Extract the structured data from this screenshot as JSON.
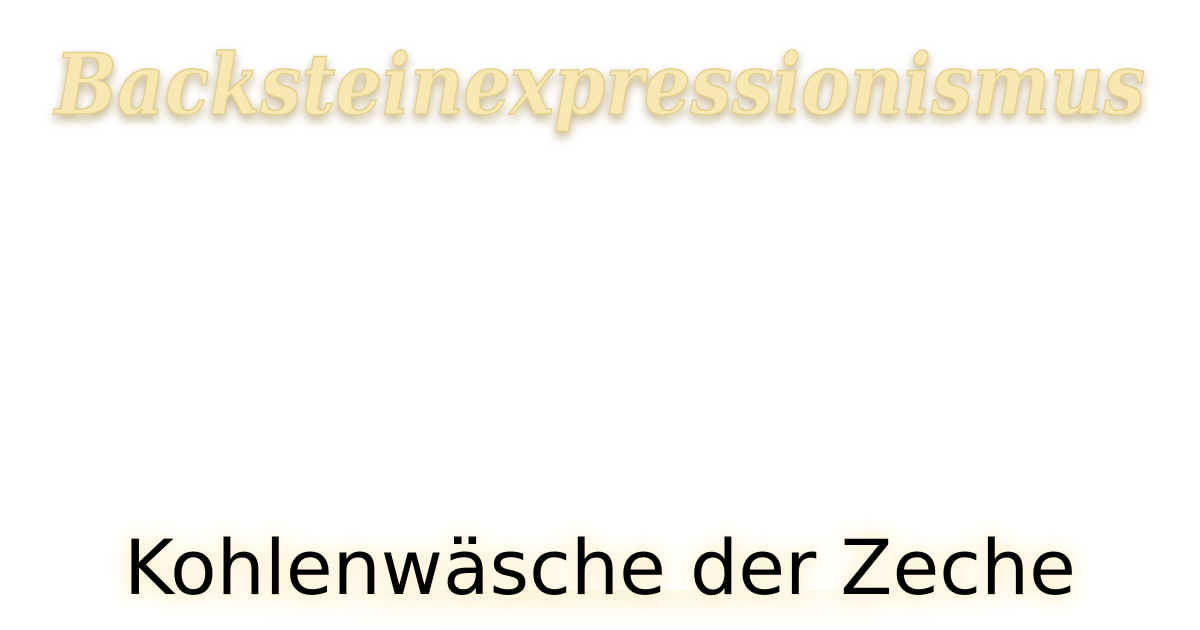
{
  "title": {
    "text": "Backsteinexpressionismus",
    "fill_color": "#f7e8b2",
    "stroke_color": "#e3cf8c",
    "glow_color": "#b8a77a"
  },
  "caption": {
    "text": "Kohlenwäsche der Zeche"
  },
  "colors": {
    "background": "#ffffff",
    "caption_text": "#000000"
  }
}
